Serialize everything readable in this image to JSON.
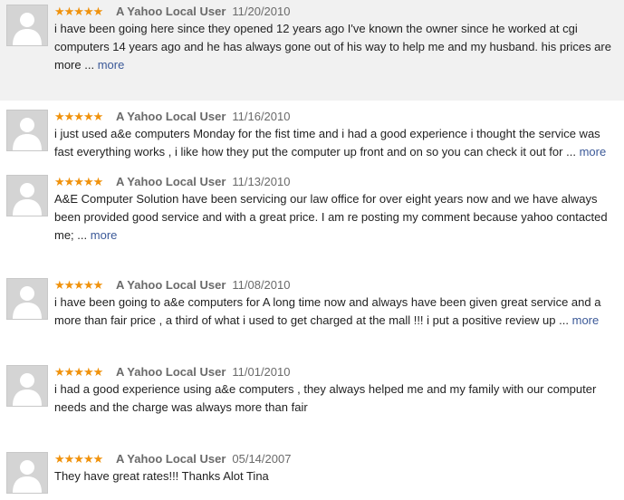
{
  "reviews": [
    {
      "stars": "★★★★★",
      "user": "A Yahoo Local User",
      "date": "11/20/2010",
      "text": "i have been going here since they opened 12 years ago I've known the owner since he worked at cgi computers 14 years ago and he has always gone out of his way to help me and my husband. his prices are more",
      "ellipsis": "...",
      "more": "more",
      "highlighted": true
    },
    {
      "stars": "★★★★★",
      "user": "A Yahoo Local User",
      "date": "11/16/2010",
      "text": "i just used a&e computers Monday for the fist time and i had a good experience i thought the service was fast everything works , i like how they put the computer up front and on so you can check it out for",
      "ellipsis": "...",
      "more": "more"
    },
    {
      "stars": "★★★★★",
      "user": "A Yahoo Local User",
      "date": "11/13/2010",
      "text": "A&E Computer Solution have been servicing our law office for over eight years now and we have always been provided good service and with a great price. I am re posting my comment because yahoo contacted me;",
      "ellipsis": "...",
      "more": "more"
    },
    {
      "stars": "★★★★★",
      "user": "A Yahoo Local User",
      "date": "11/08/2010",
      "text": "i have been going to a&e computers for A long time now and always have been given great service and a more than fair price , a third of what i used to get charged at the mall !!! i put a positive review up",
      "ellipsis": "...",
      "more": "more"
    },
    {
      "stars": "★★★★★",
      "user": "A Yahoo Local User",
      "date": "11/01/2010",
      "text": "i had a good experience using a&e computers , they always helped me and my family with our computer needs and the charge was always more than fair"
    },
    {
      "stars": "★★★★★",
      "user": "A Yahoo Local User",
      "date": "05/14/2007",
      "text": "They have great rates!!! Thanks Alot Tina"
    }
  ]
}
